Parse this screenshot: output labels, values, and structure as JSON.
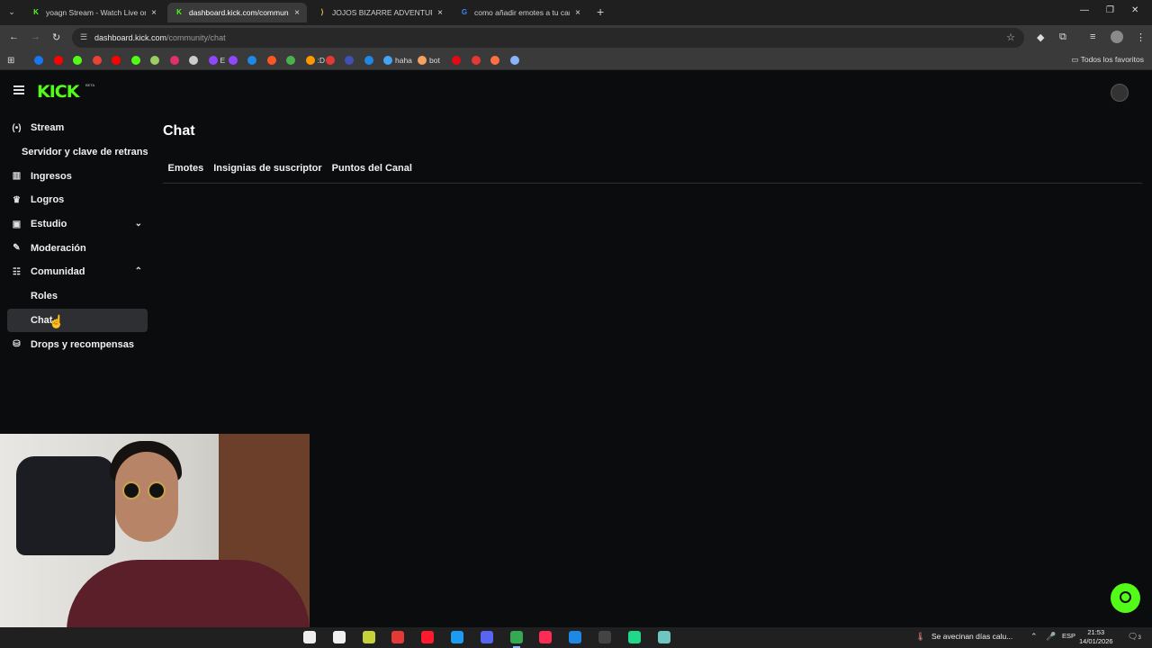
{
  "browser": {
    "tabs": [
      {
        "title": "yoagn Stream - Watch Live on",
        "active": false
      },
      {
        "title": "dashboard.kick.com/communit",
        "active": true
      },
      {
        "title": "JOJOS BIZARRE ADVENTURE G",
        "active": false
      },
      {
        "title": "como añadir emotes a tu canal",
        "active": false
      }
    ],
    "close_glyph": "×",
    "new_tab_glyph": "+",
    "window_controls": [
      "—",
      "❐",
      "✕"
    ],
    "url_host": "dashboard.kick.com",
    "url_path": "/community/chat",
    "bookmarks": [
      {
        "label": "",
        "color": "#1877f2"
      },
      {
        "label": "",
        "color": "#ff0000"
      },
      {
        "label": "",
        "color": "#53fc18"
      },
      {
        "label": "",
        "color": "#ea4335"
      },
      {
        "label": "",
        "color": "#ff0000"
      },
      {
        "label": "",
        "color": "#53fc18"
      },
      {
        "label": "",
        "color": "#9ccc65"
      },
      {
        "label": "",
        "color": "#e1306c"
      },
      {
        "label": "",
        "color": "#cccccc"
      },
      {
        "label": "E",
        "color": "#9146ff"
      },
      {
        "label": "",
        "color": "#9146ff"
      },
      {
        "label": "",
        "color": "#1e88e5"
      },
      {
        "label": "",
        "color": "#ff5722"
      },
      {
        "label": "",
        "color": "#4caf50"
      },
      {
        "label": ":D",
        "color": "#ff9800"
      },
      {
        "label": "",
        "color": "#e53935"
      },
      {
        "label": "",
        "color": "#3f51b5"
      },
      {
        "label": "",
        "color": "#1e88e5"
      },
      {
        "label": "haha",
        "color": "#42a5f5"
      },
      {
        "label": "bot",
        "color": "#f4a261"
      },
      {
        "label": "",
        "color": "#e50914"
      },
      {
        "label": "",
        "color": "#e53935"
      },
      {
        "label": "",
        "color": "#ff7043"
      },
      {
        "label": "",
        "color": "#8ab4f8"
      }
    ],
    "all_bookmarks_label": "Todos los favoritos"
  },
  "kick": {
    "logo": "KICK",
    "logo_beta": "BETA",
    "sidebar": [
      {
        "label": "Stream",
        "icon": "broadcast-icon",
        "glyph": "(•)",
        "level": 0
      },
      {
        "label": "Servidor y clave de retransmisión",
        "icon": "",
        "glyph": "",
        "level": 2
      },
      {
        "label": "Ingresos",
        "icon": "chart-icon",
        "glyph": "▥",
        "level": 0
      },
      {
        "label": "Logros",
        "icon": "trophy-icon",
        "glyph": "♛",
        "level": 0
      },
      {
        "label": "Estudio",
        "icon": "studio-icon",
        "glyph": "▣",
        "level": 0,
        "chevron": "⌄"
      },
      {
        "label": "Moderación",
        "icon": "wrench-icon",
        "glyph": "✎",
        "level": 0
      },
      {
        "label": "Comunidad",
        "icon": "people-icon",
        "glyph": "☷",
        "level": 0,
        "chevron": "⌃"
      },
      {
        "label": "Roles",
        "icon": "",
        "glyph": "",
        "level": 1
      },
      {
        "label": "Chat",
        "icon": "",
        "glyph": "",
        "level": 1,
        "selected": true
      },
      {
        "label": "Drops y recompensas",
        "icon": "gift-icon",
        "glyph": "⛁",
        "level": 0
      }
    ],
    "page_title": "Chat",
    "tabs": [
      "Emotes",
      "Insignias de suscriptor",
      "Puntos del Canal"
    ],
    "accent": "#53fc18"
  },
  "taskbar": {
    "apps": [
      {
        "name": "start-icon",
        "color": "#eeeeee",
        "active": false
      },
      {
        "name": "osu-icon",
        "color": "#f0f0f0",
        "active": false
      },
      {
        "name": "app-green-icon",
        "color": "#c7d13a",
        "active": false
      },
      {
        "name": "app-red-icon",
        "color": "#e53935",
        "active": false
      },
      {
        "name": "opera-icon",
        "color": "#ff1b2d",
        "active": false
      },
      {
        "name": "steam-icon",
        "color": "#1b9cf2",
        "active": false
      },
      {
        "name": "discord-icon",
        "color": "#5865f2",
        "active": false
      },
      {
        "name": "chrome-icon",
        "color": "#34a853",
        "active": true
      },
      {
        "name": "tiktok-icon",
        "color": "#fe2c55",
        "active": false
      },
      {
        "name": "vscode-icon",
        "color": "#1e88e5",
        "active": false
      },
      {
        "name": "terminal-icon",
        "color": "#444444",
        "active": false
      },
      {
        "name": "pycharm-icon",
        "color": "#21d789",
        "active": false
      },
      {
        "name": "app-teal-icon",
        "color": "#6ec6c0",
        "active": false
      }
    ],
    "weather_text": "Se avecinan días calu...",
    "language": "ESP",
    "time": "21:53",
    "date": "14/01/2026",
    "notifications": "3"
  }
}
